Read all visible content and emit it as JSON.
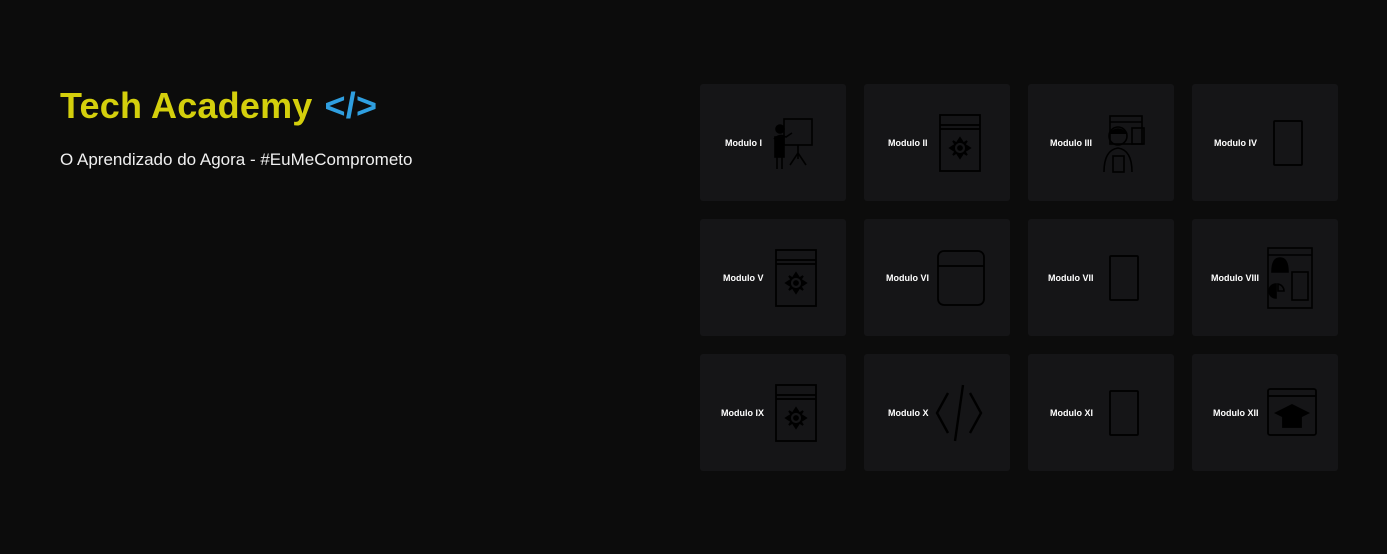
{
  "hero": {
    "title": "Tech Academy",
    "title_code": "</>",
    "subtitle": "O Aprendizado do Agora - #EuMeComprometo"
  },
  "colors": {
    "background": "#0c0c0c",
    "card": "#151517",
    "title": "#d4cf0c",
    "code": "#2f9fe0",
    "text": "#ffffff",
    "icon_stroke": "#000000"
  },
  "modules": [
    {
      "label": "Modulo I",
      "icon": "presenter-icon"
    },
    {
      "label": "Modulo II",
      "icon": "gear-window-icon"
    },
    {
      "label": "Modulo III",
      "icon": "developer-icon"
    },
    {
      "label": "Modulo IV",
      "icon": "tablet-icon"
    },
    {
      "label": "Modulo V",
      "icon": "gear-window-icon"
    },
    {
      "label": "Modulo VI",
      "icon": "browser-window-icon"
    },
    {
      "label": "Modulo VII",
      "icon": "tablet-icon"
    },
    {
      "label": "Modulo VIII",
      "icon": "dashboard-window-icon"
    },
    {
      "label": "Modulo IX",
      "icon": "gear-window-icon"
    },
    {
      "label": "Modulo X",
      "icon": "code-brackets-icon"
    },
    {
      "label": "Modulo XI",
      "icon": "tablet-icon"
    },
    {
      "label": "Modulo XII",
      "icon": "graduation-screen-icon"
    }
  ]
}
